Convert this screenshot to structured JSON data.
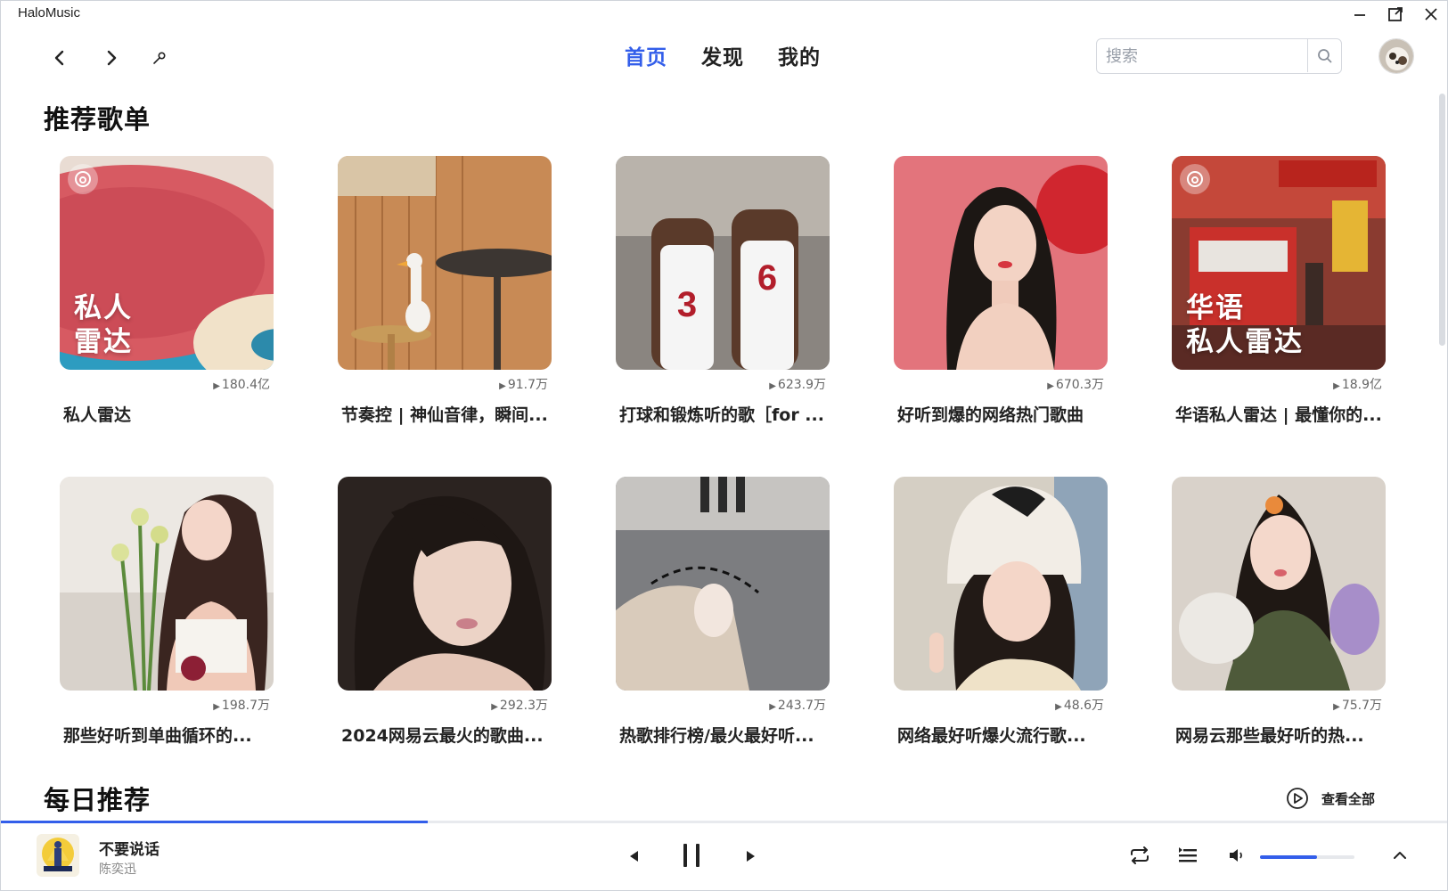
{
  "app": {
    "title": "HaloMusic"
  },
  "header": {
    "tabs": [
      {
        "label": "首页",
        "active": true
      },
      {
        "label": "发现",
        "active": false
      },
      {
        "label": "我的",
        "active": false
      }
    ],
    "search": {
      "placeholder": "搜索",
      "value": ""
    }
  },
  "sections": {
    "recommended_title": "推荐歌单",
    "daily_title": "每日推荐",
    "see_all_label": "查看全部"
  },
  "playlists": [
    {
      "title": "私人雷达",
      "plays": "180.4亿",
      "cover_text": [
        "私人",
        "雷达"
      ]
    },
    {
      "title": "节奏控 | 神仙音律，瞬间...",
      "plays": "91.7万"
    },
    {
      "title": "打球和锻炼听的歌［for ...",
      "plays": "623.9万"
    },
    {
      "title": "好听到爆的网络热门歌曲",
      "plays": "670.3万"
    },
    {
      "title": "华语私人雷达 | 最懂你的...",
      "plays": "18.9亿",
      "cover_text": [
        "华语",
        "私人雷达"
      ]
    },
    {
      "title": "那些好听到单曲循环的...",
      "plays": "198.7万"
    },
    {
      "title": "2024网易云最火的歌曲...",
      "plays": "292.3万"
    },
    {
      "title": "热歌排行榜/最火最好听...",
      "plays": "243.7万"
    },
    {
      "title": "网络最好听爆火流行歌...",
      "plays": "48.6万"
    },
    {
      "title": "网易云那些最好听的热...",
      "plays": "75.7万"
    }
  ],
  "player": {
    "track_title": "不要说话",
    "artist": "陈奕迅",
    "progress": 0.295,
    "volume": 0.6
  },
  "colors": {
    "accent": "#335eea"
  }
}
